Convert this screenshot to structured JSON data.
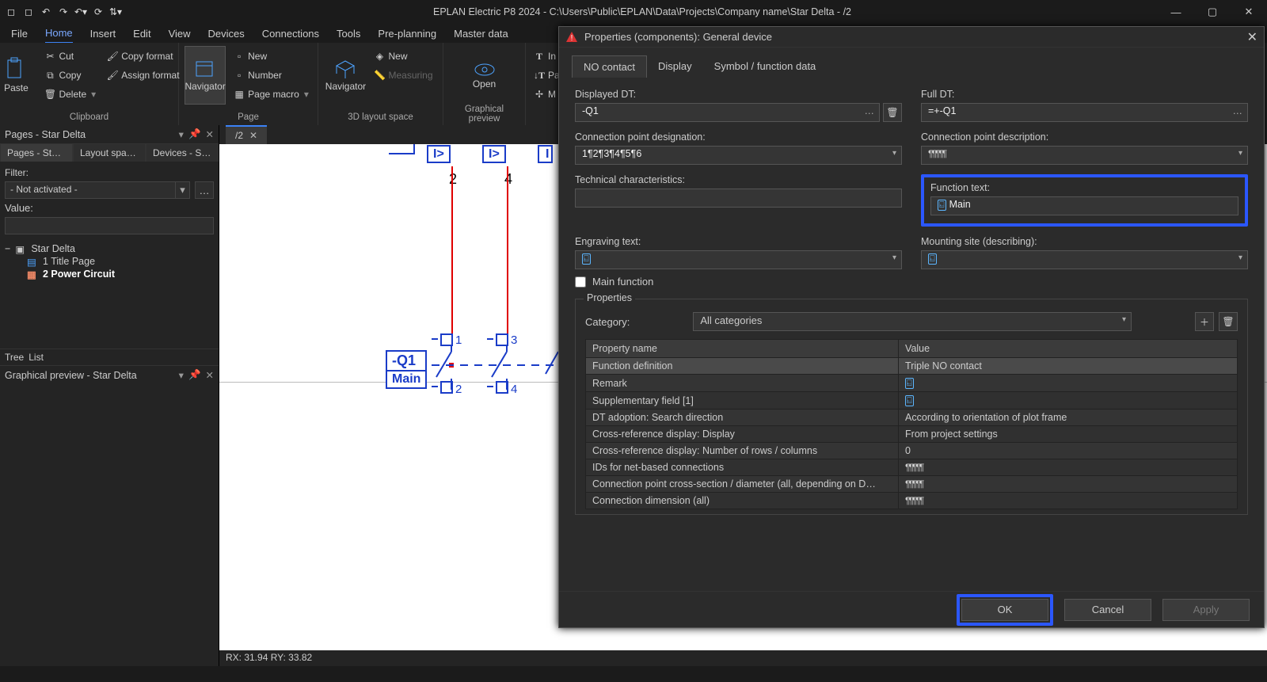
{
  "title": "EPLAN Electric P8 2024 - C:\\Users\\Public\\EPLAN\\Data\\Projects\\Company name\\Star Delta - /2",
  "menu_tabs": [
    "File",
    "Home",
    "Insert",
    "Edit",
    "View",
    "Devices",
    "Connections",
    "Tools",
    "Pre-planning",
    "Master data"
  ],
  "active_menu_tab": "Home",
  "ribbon": {
    "clipboard": {
      "paste": "Paste",
      "cut": "Cut",
      "copy": "Copy",
      "delete": "Delete",
      "copy_format": "Copy format",
      "assign_format": "Assign format",
      "label": "Clipboard"
    },
    "page": {
      "navigator": "Navigator",
      "new": "New",
      "number": "Number",
      "page_macro": "Page macro",
      "label": "Page"
    },
    "layout3d": {
      "navigator": "Navigator",
      "new": "New",
      "measuring": "Measuring",
      "label": "3D layout space"
    },
    "preview": {
      "open": "Open",
      "label": "Graphical preview"
    },
    "right_items": [
      "In",
      "Pa",
      "M"
    ]
  },
  "left": {
    "pages_header": "Pages - Star Delta",
    "inner_tabs": [
      "Pages - Star D…",
      "Layout space -…",
      "Devices - Star …"
    ],
    "active_inner_tab": 0,
    "filter_label": "Filter:",
    "filter_value": "- Not activated -",
    "ellipsis": "…",
    "value_label": "Value:",
    "tree": {
      "root": "Star Delta",
      "items": [
        {
          "label": "1 Title Page",
          "bold": false
        },
        {
          "label": "2 Power Circuit",
          "bold": true
        }
      ]
    },
    "bottom_tabs": [
      "Tree",
      "List"
    ],
    "preview_header": "Graphical preview - Star Delta"
  },
  "editor": {
    "doc_tab": "/2",
    "canvas": {
      "dev_label": "-Q1",
      "dev_sub": "Main",
      "io_box": "I>",
      "pins_top": [
        "2",
        "4"
      ],
      "pins_bot_l": [
        "1",
        "3"
      ],
      "pins_bot_r": [
        "2",
        "4"
      ]
    },
    "status": "RX: 31.94 RY: 33.82"
  },
  "dialog": {
    "title": "Properties (components): General device",
    "tabs": [
      "NO contact",
      "Display",
      "Symbol / function data"
    ],
    "active_tab": 0,
    "fields": {
      "displayed_dt_label": "Displayed DT:",
      "displayed_dt": "-Q1",
      "full_dt_label": "Full DT:",
      "full_dt": "=+-Q1",
      "conn_desig_label": "Connection point designation:",
      "conn_desig": "1¶2¶3¶4¶5¶6",
      "conn_desc_label": "Connection point description:",
      "conn_desc": "¶¶¶¶¶",
      "tech_char_label": "Technical characteristics:",
      "tech_char": "",
      "func_text_label": "Function text:",
      "func_text": "Main",
      "engraving_label": "Engraving text:",
      "engraving": "",
      "mounting_label": "Mounting site (describing):",
      "mounting": "",
      "main_func_label": "Main function"
    },
    "props": {
      "legend": "Properties",
      "category_label": "Category:",
      "category_value": "All categories",
      "columns": [
        "Property name",
        "Value"
      ],
      "rows": [
        {
          "name": "Function definition",
          "value": "Triple NO contact",
          "selected": true,
          "type": "text"
        },
        {
          "name": "Remark",
          "value": "",
          "type": "lang"
        },
        {
          "name": "Supplementary field [1]",
          "value": "",
          "type": "lang"
        },
        {
          "name": "DT adoption: Search direction",
          "value": "According to orientation of plot frame",
          "type": "text"
        },
        {
          "name": "Cross-reference display: Display",
          "value": "From project settings",
          "type": "text"
        },
        {
          "name": "Cross-reference display: Number of rows / columns",
          "value": "0",
          "type": "text"
        },
        {
          "name": "IDs for net-based connections",
          "value": "¶¶¶¶¶",
          "type": "pil"
        },
        {
          "name": "Connection point cross-section / diameter (all, depending on D…",
          "value": "¶¶¶¶¶",
          "type": "pil"
        },
        {
          "name": "Connection dimension (all)",
          "value": "¶¶¶¶¶",
          "type": "pil"
        }
      ]
    },
    "buttons": {
      "ok": "OK",
      "cancel": "Cancel",
      "apply": "Apply"
    }
  }
}
